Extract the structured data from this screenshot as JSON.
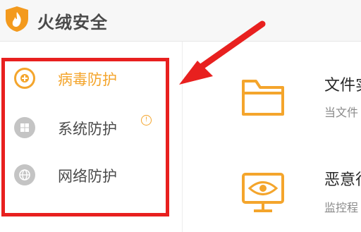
{
  "app": {
    "title": "火绒安全"
  },
  "sidebar": {
    "items": [
      {
        "label": "病毒防护",
        "icon": "plus-circle-icon",
        "active": true
      },
      {
        "label": "系统防护",
        "icon": "windows-icon",
        "badge": "!"
      },
      {
        "label": "网络防护",
        "icon": "globe-icon"
      }
    ]
  },
  "main": {
    "items": [
      {
        "title": "文件实",
        "desc": "当文件",
        "icon": "folder-icon"
      },
      {
        "title": "恶意行",
        "desc": "监控程",
        "icon": "monitor-eye-icon"
      }
    ]
  },
  "colors": {
    "accent": "#f4a52c",
    "annotation": "#e8201f",
    "icon_gray": "#c4c4c4"
  }
}
